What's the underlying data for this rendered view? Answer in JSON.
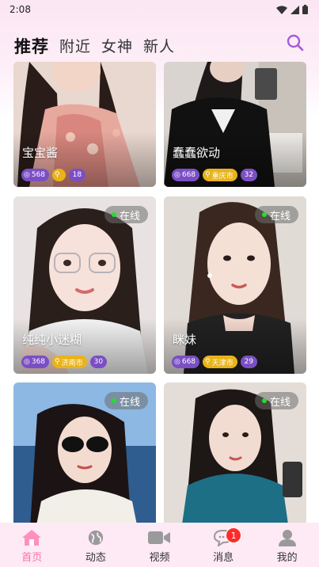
{
  "status_bar": {
    "time": "2:08"
  },
  "tabs": [
    {
      "label": "推荐",
      "active": true
    },
    {
      "label": "附近",
      "active": false
    },
    {
      "label": "女神",
      "active": false
    },
    {
      "label": "新人",
      "active": false
    }
  ],
  "accent_color": "#9b59d6",
  "cards": [
    {
      "name": "宝宝酱",
      "views": "568",
      "city": "",
      "age": "18",
      "online": ""
    },
    {
      "name": "蠢蠢欲动",
      "views": "668",
      "city": "重庆市",
      "age": "32",
      "online": ""
    },
    {
      "name": "纯纯小迷糊",
      "views": "368",
      "city": "济南市",
      "age": "30",
      "online": "在线"
    },
    {
      "name": "眯妹",
      "views": "668",
      "city": "天津市",
      "age": "29",
      "online": "在线"
    },
    {
      "name": "",
      "views": "",
      "city": "",
      "age": "",
      "online": "在线"
    },
    {
      "name": "",
      "views": "",
      "city": "",
      "age": "",
      "online": "在线"
    }
  ],
  "bottom_nav": [
    {
      "label": "首页",
      "icon": "home-icon",
      "active": true
    },
    {
      "label": "动态",
      "icon": "globe-icon",
      "active": false
    },
    {
      "label": "视频",
      "icon": "video-icon",
      "active": false
    },
    {
      "label": "消息",
      "icon": "message-icon",
      "active": false,
      "badge": "1"
    },
    {
      "label": "我的",
      "icon": "profile-icon",
      "active": false
    }
  ]
}
